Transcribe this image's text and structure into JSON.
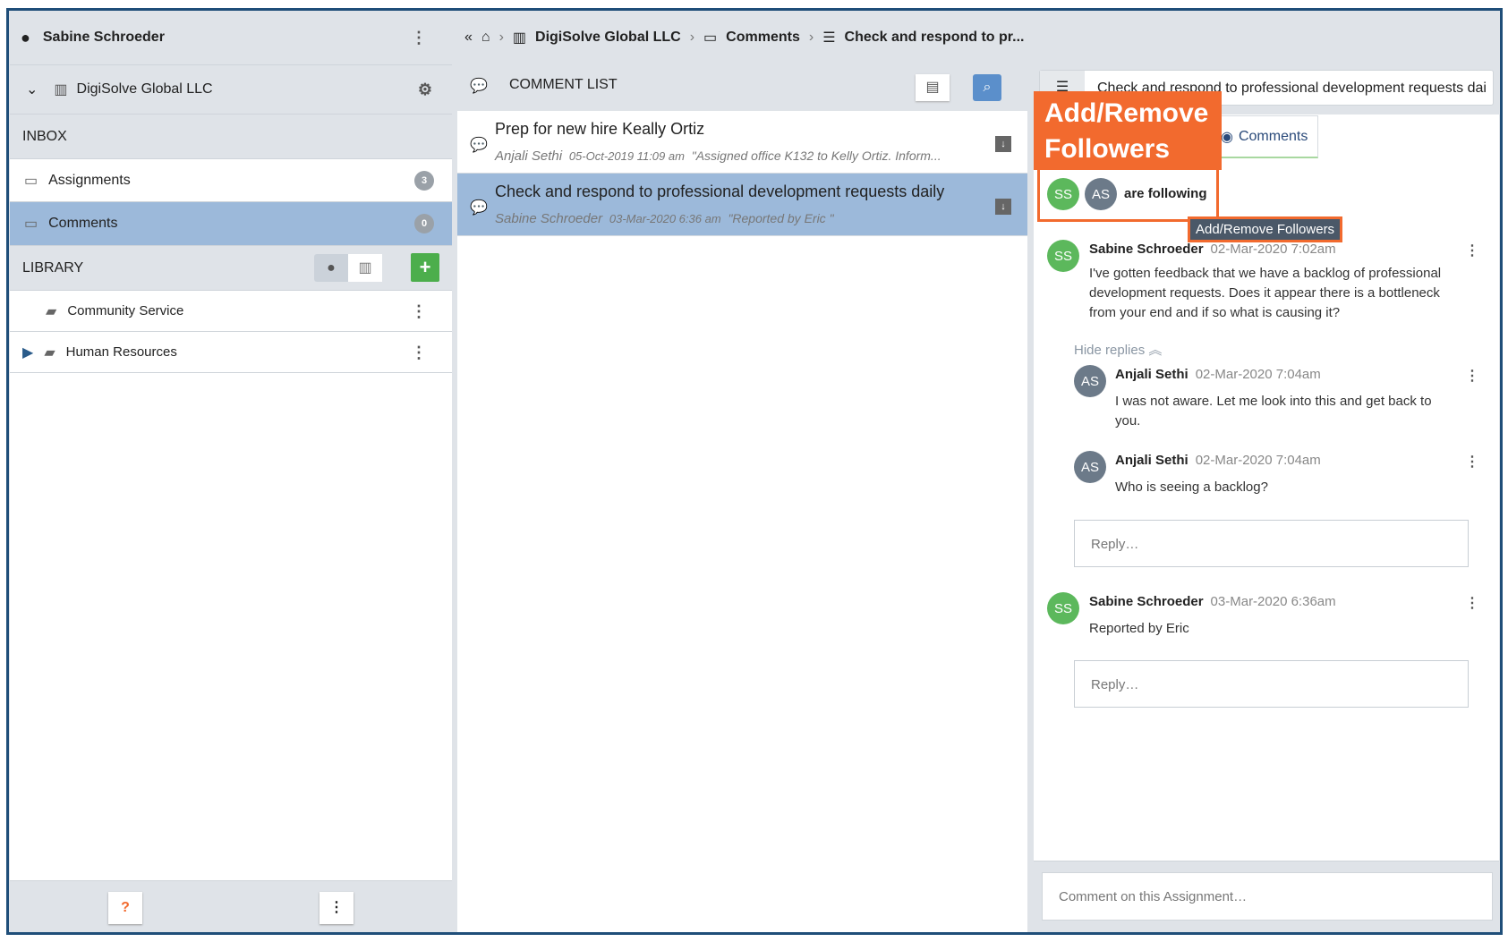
{
  "sidebar": {
    "user": "Sabine Schroeder",
    "org": "DigiSolve Global LLC",
    "inbox_label": "INBOX",
    "inbox_items": [
      {
        "label": "Assignments",
        "count": "3"
      },
      {
        "label": "Comments",
        "count": "0"
      }
    ],
    "library_label": "LIBRARY",
    "library_items": [
      {
        "label": "Community Service"
      },
      {
        "label": "Human Resources"
      }
    ]
  },
  "breadcrumb": {
    "org": "DigiSolve Global LLC",
    "section": "Comments",
    "item": "Check and respond to pr..."
  },
  "comment_list": {
    "title": "COMMENT LIST",
    "items": [
      {
        "title": "Prep for new hire Keally Ortiz",
        "author": "Anjali Sethi",
        "date": "05-Oct-2019 11:09 am",
        "preview": "\"Assigned office K132 to Kelly Ortiz. Inform..."
      },
      {
        "title": "Check and respond to professional development requests daily",
        "author": "Sabine Schroeder",
        "date": "03-Mar-2020 6:36 am",
        "preview": "\"Reported by Eric \""
      }
    ]
  },
  "detail": {
    "title": "Check and respond to professional development requests daily",
    "tab": "Comments",
    "followers": [
      "SS",
      "AS"
    ],
    "following_text": "are following",
    "tooltip": "Add/Remove Followers",
    "callout": "Add/Remove Followers",
    "hide_replies": "Hide replies",
    "reply_placeholder": "Reply…",
    "comment_placeholder": "Comment on this Assignment…",
    "comments": [
      {
        "initials": "SS",
        "author": "Sabine Schroeder",
        "date": "02-Mar-2020 7:02am",
        "text": "I've gotten feedback that we have a backlog of professional development requests. Does it appear there is a bottleneck from your end and if so what is causing it?"
      },
      {
        "initials": "AS",
        "author": "Anjali Sethi",
        "date": "02-Mar-2020 7:04am",
        "text": "I was not aware. Let me look into this and get back to you."
      },
      {
        "initials": "AS",
        "author": "Anjali Sethi",
        "date": "02-Mar-2020 7:04am",
        "text": "Who is seeing a backlog?"
      },
      {
        "initials": "SS",
        "author": "Sabine Schroeder",
        "date": "03-Mar-2020 6:36am",
        "text": "Reported by Eric"
      }
    ]
  },
  "colors": {
    "accent": "#f26a2e",
    "selected": "#9cb9da",
    "frame": "#1f4e79"
  }
}
